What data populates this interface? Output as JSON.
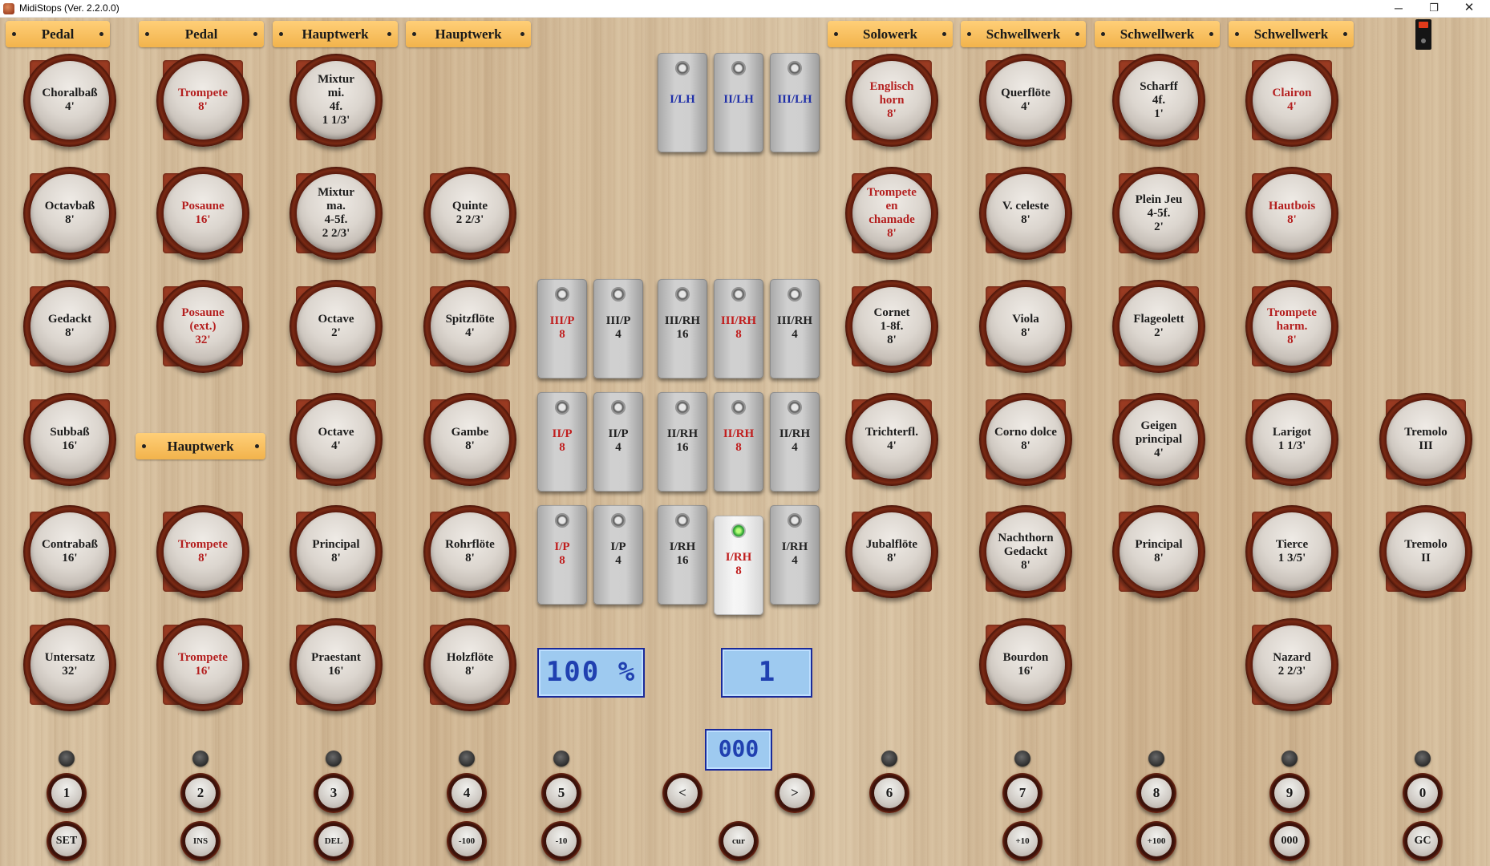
{
  "window": {
    "title": "MidiStops (Ver. 2.2.0.0)",
    "minimize": "─",
    "maximize": "❐",
    "close": "✕"
  },
  "divisions": [
    "Pedal",
    "Pedal",
    "Hauptwerk",
    "Hauptwerk",
    "Solowerk",
    "Schwellwerk",
    "Schwellwerk",
    "Schwellwerk",
    "Hauptwerk"
  ],
  "stops": [
    [
      "Choralbaß\n4'",
      "Octavbaß\n8'",
      "Gedackt\n8'",
      "Subbaß\n16'",
      "Contrabaß\n16'",
      "Untersatz\n32'"
    ],
    [
      "Trompete\n8'",
      "Posaune\n16'",
      "Posaune\n(ext.)\n32'",
      "Trompete\n8'",
      "Trompete\n16'"
    ],
    [
      "Mixtur\nmi.\n4f.\n1 1/3'",
      "Mixtur\nma.\n4-5f.\n2 2/3'",
      "Octave\n2'",
      "Octave\n4'",
      "Principal\n8'",
      "Praestant\n16'"
    ],
    [
      "Quinte\n2 2/3'",
      "Spitzflöte\n4'",
      "Gambe\n8'",
      "Rohrflöte\n8'",
      "Holzflöte\n8'"
    ],
    [
      "Englisch\nhorn\n8'",
      "Trompete\nen\nchamade\n8'",
      "Cornet\n1-8f.\n8'",
      "Trichterfl.\n4'",
      "Jubalflöte\n8'"
    ],
    [
      "Querflöte\n4'",
      "V. celeste\n8'",
      "Viola\n8'",
      "Corno dolce\n8'",
      "Nachthorn\nGedackt\n8'",
      "Bourdon\n16'"
    ],
    [
      "Scharff\n4f.\n1'",
      "Plein Jeu\n4-5f.\n2'",
      "Flageolett\n2'",
      "Geigen\nprincipal\n4'",
      "Principal\n8'"
    ],
    [
      "Clairon\n4'",
      "Hautbois\n8'",
      "Trompete\nharm.\n8'",
      "Larigot\n1 1/3'",
      "Tierce\n1 3/5'",
      "Nazard\n2 2/3'"
    ],
    [
      "Tremolo\nIII",
      "Tremolo\nII"
    ]
  ],
  "couplers": {
    "row0": [
      "I/LH",
      "II/LH",
      "III/LH"
    ],
    "row1": [
      "III/P\n8",
      "III/P\n4",
      "III/RH\n16",
      "III/RH\n8",
      "III/RH\n4"
    ],
    "row2": [
      "II/P\n8",
      "II/P\n4",
      "II/RH\n16",
      "II/RH\n8",
      "II/RH\n4"
    ],
    "row3": [
      "I/P\n8",
      "I/P\n4",
      "I/RH\n16",
      "I/RH\n8",
      "I/RH\n4"
    ]
  },
  "displays": {
    "volume": "100 %",
    "memory": "1",
    "sequence": "000"
  },
  "pistons": {
    "numbers": [
      "1",
      "2",
      "3",
      "4",
      "5",
      "<",
      ">",
      "6",
      "7",
      "8",
      "9",
      "0"
    ],
    "functions": [
      "SET",
      "INS",
      "DEL",
      "-100",
      "-10",
      "cur",
      "+10",
      "+100",
      "000",
      "GC"
    ]
  },
  "colors": {
    "active_text": "#b41f1f",
    "manual_text": "#1f2fa8",
    "division_label": "#f2b34c",
    "lcd_background": "#9ecaf0",
    "led_on": "#1f9a2a"
  }
}
